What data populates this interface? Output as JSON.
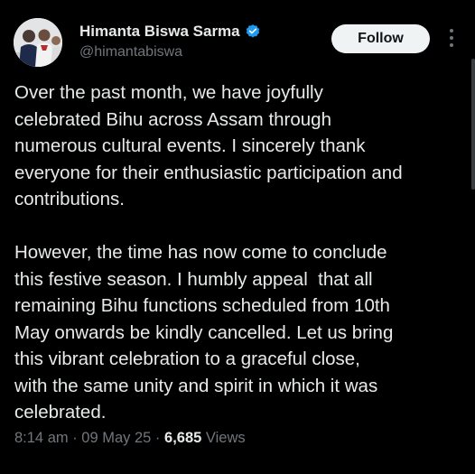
{
  "author": {
    "display_name": "Himanta Biswa Sarma",
    "handle": "@himantabiswa",
    "verified_icon": "verified-badge-icon",
    "verified_color": "#1d9bf0"
  },
  "actions": {
    "follow_label": "Follow",
    "more_icon": "more-vertical-icon"
  },
  "tweet": {
    "paragraphs": [
      "Over the past month, we have joyfully\ncelebrated Bihu across Assam through\nnumerous cultural events. I sincerely thank\neveryone for their enthusiastic participation and\ncontributions.",
      "However, the time has now come to conclude\nthis festive season. I humbly appeal  that all\nremaining Bihu functions scheduled from 10th\nMay onwards be kindly cancelled. Let us bring\nthis vibrant celebration to a graceful close,\nwith the same unity and spirit in which it was\ncelebrated."
    ],
    "time": "8:14 am",
    "separator": " · ",
    "date": "09 May 25",
    "views_count": "6,685",
    "views_label": " Views"
  },
  "colors": {
    "background": "#000000",
    "text": "#e7e9ea",
    "secondary": "#71767b",
    "button_bg": "#eff3f4"
  }
}
